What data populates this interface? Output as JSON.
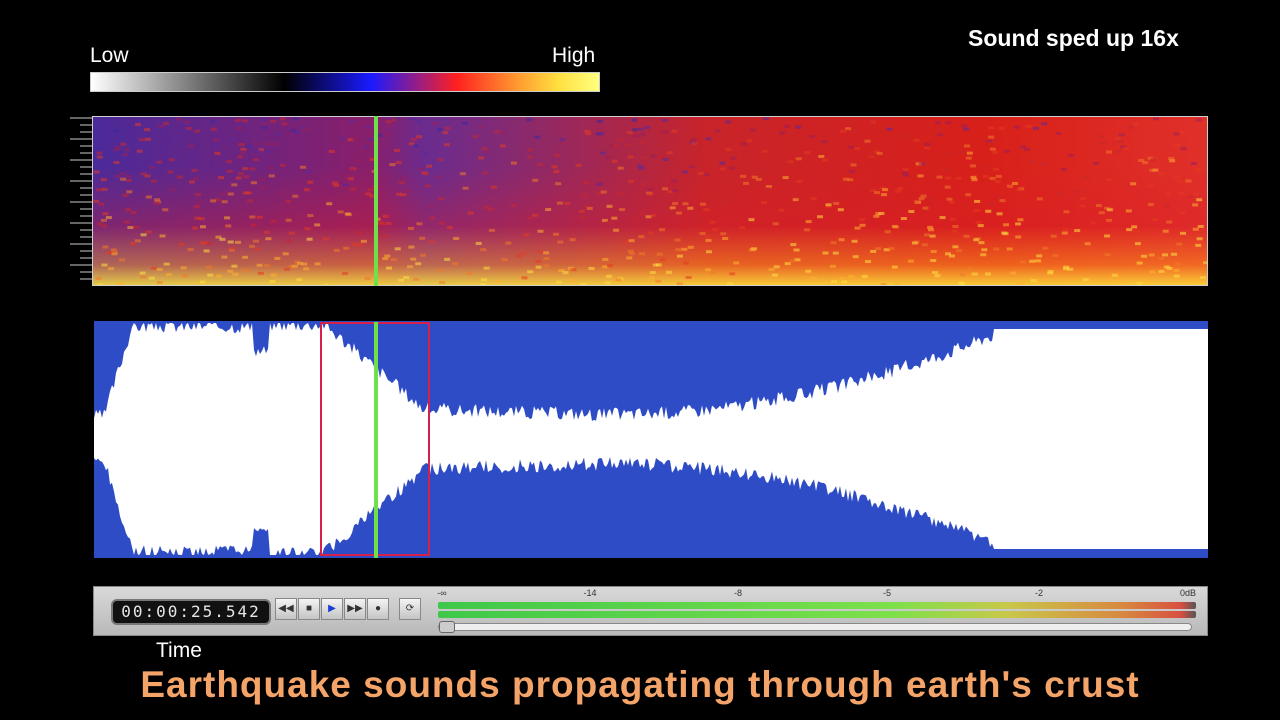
{
  "legend": {
    "low_label": "Low",
    "high_label": "High",
    "gradient_colors": [
      "#ffffff",
      "#000000",
      "#1a1aff",
      "#ff2020",
      "#ff9a30",
      "#ffe040",
      "#ffff80"
    ]
  },
  "speed_note": "Sound sped up 16x",
  "transport": {
    "time": "00:00:25.542",
    "buttons": [
      {
        "name": "rewind",
        "glyph": "◀◀"
      },
      {
        "name": "stop",
        "glyph": "■"
      },
      {
        "name": "play",
        "glyph": "▶"
      },
      {
        "name": "fast-forward",
        "glyph": "▶▶"
      },
      {
        "name": "record",
        "glyph": "●"
      },
      {
        "name": "loop",
        "glyph": "⟳"
      }
    ],
    "meter_ticks": [
      "-∞",
      "-14",
      "-8",
      "-5",
      "-2",
      "0dB"
    ],
    "playback_position": 0.25
  },
  "time_label": "Time",
  "caption": "Earthquake sounds propagating through earth's crust",
  "colors": {
    "playhead": "#6fe04a",
    "selection": "#d62049",
    "waveform_bg": "#2e4cc6",
    "caption": "#f4a468"
  }
}
